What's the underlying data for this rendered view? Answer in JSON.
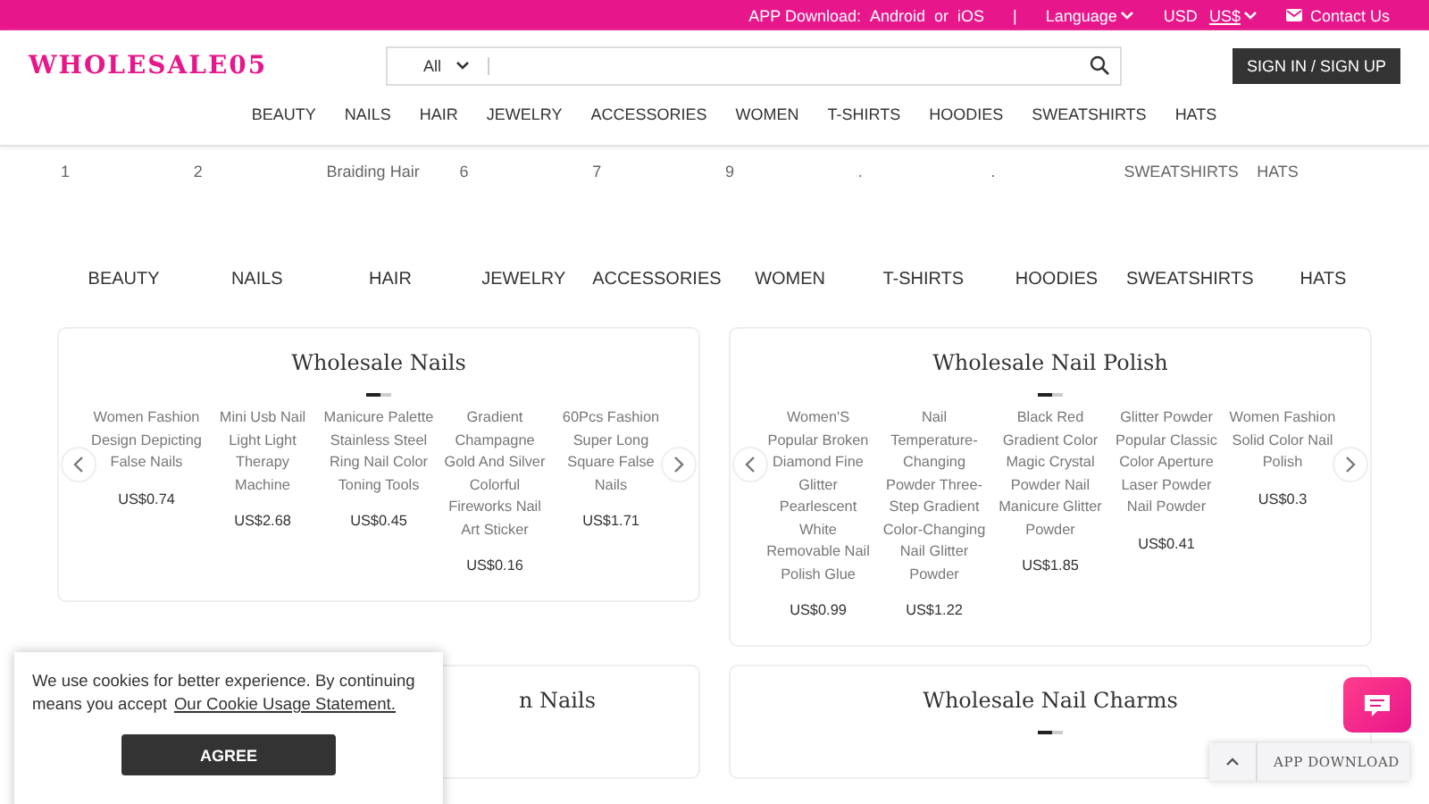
{
  "top_bar": {
    "app_download": "APP Download:",
    "android": "Android",
    "or": "or",
    "ios": "iOS",
    "separator": "|",
    "language": "Language",
    "currency_code": "USD",
    "currency": "US$",
    "contact": "Contact Us"
  },
  "header": {
    "logo": "WHOLESALE05",
    "search": {
      "category": "All"
    },
    "sign_in": "SIGN IN / SIGN UP"
  },
  "nav": [
    "BEAUTY",
    "NAILS",
    "HAIR",
    "JEWELRY",
    "ACCESSORIES",
    "WOMEN",
    "T-SHIRTS",
    "HOODIES",
    "SWEATSHIRTS",
    "HATS"
  ],
  "sub_row": [
    "1",
    "2",
    "Braiding Hair",
    "6",
    "7",
    "9",
    ".",
    ".",
    "SWEATSHIRTS",
    "HATS"
  ],
  "categories": [
    "BEAUTY",
    "NAILS",
    "HAIR",
    "JEWELRY",
    "ACCESSORIES",
    "WOMEN",
    "T-SHIRTS",
    "HOODIES",
    "SWEATSHIRTS",
    "HATS"
  ],
  "sections": [
    {
      "title": "Wholesale Nails",
      "products": [
        {
          "name": "Women Fashion Design Depicting False Nails",
          "price": "US$0.74"
        },
        {
          "name": "Mini Usb Nail Light Light Therapy Machine",
          "price": "US$2.68"
        },
        {
          "name": "Manicure Palette Stainless Steel Ring Nail Color Toning Tools",
          "price": "US$0.45"
        },
        {
          "name": "Gradient Champagne Gold And Silver Colorful Fireworks Nail Art Sticker",
          "price": "US$0.16"
        },
        {
          "name": "60Pcs Fashion Super Long Square False Nails",
          "price": "US$1.71"
        }
      ]
    },
    {
      "title": "Wholesale Nail Polish",
      "products": [
        {
          "name": "Women'S Popular Broken Diamond Fine Glitter Pearlescent White Removable Nail Polish Glue",
          "price": "US$0.99"
        },
        {
          "name": "Nail Temperature-Changing Powder Three-Step Gradient Color-Changing Nail Glitter Powder",
          "price": "US$1.22"
        },
        {
          "name": "Black Red Gradient Color Magic Crystal Powder Nail Manicure Glitter Powder",
          "price": "US$1.85"
        },
        {
          "name": "Glitter Powder Popular Classic Color Aperture Laser Powder Nail Powder",
          "price": "US$0.41"
        },
        {
          "name": "Women Fashion Solid Color Nail Polish",
          "price": "US$0.3"
        }
      ]
    },
    {
      "title": "n Nails"
    },
    {
      "title": "Wholesale Nail Charms"
    }
  ],
  "cookie": {
    "text": "We use cookies for better experience. By continuing means you accept",
    "link": "Our Cookie Usage Statement.",
    "button": "AGREE"
  },
  "app_download": "APP DOWNLOAD"
}
